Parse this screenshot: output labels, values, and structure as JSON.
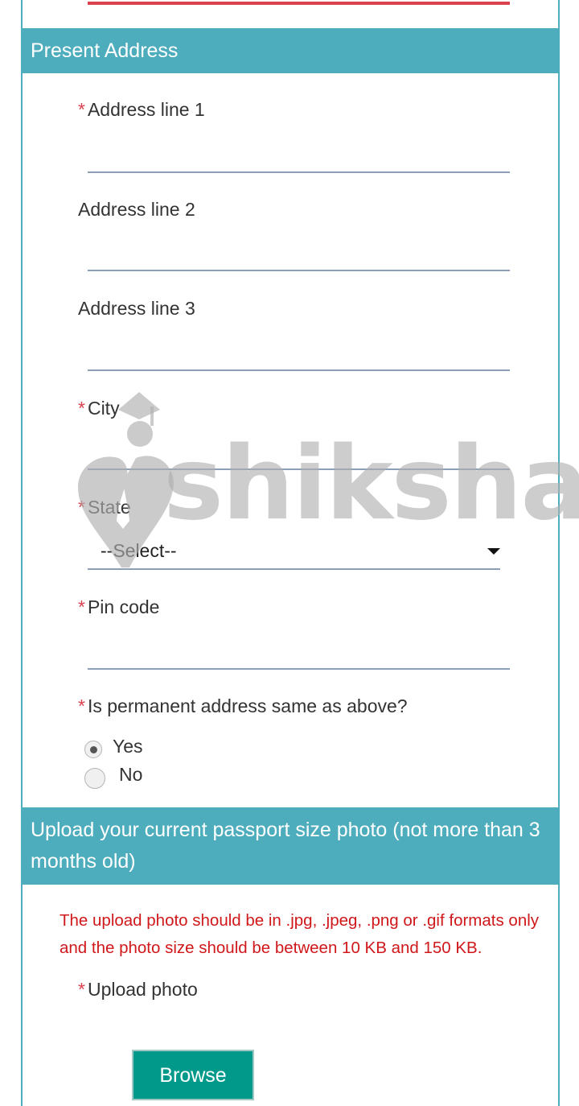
{
  "sections": {
    "present_address": "Present Address",
    "upload_photo": "Upload your current passport size photo (not more than 3 months old)"
  },
  "required_mark": "*",
  "fields": {
    "address1": {
      "label": "Address line 1",
      "value": ""
    },
    "address2": {
      "label": "Address line 2",
      "value": ""
    },
    "address3": {
      "label": "Address line 3",
      "value": ""
    },
    "city": {
      "label": "City",
      "value": ""
    },
    "state": {
      "label": "State",
      "selected": "--Select--"
    },
    "pincode": {
      "label": "Pin code",
      "value": ""
    }
  },
  "permanent_address": {
    "question": "Is permanent address same as above?",
    "options": [
      {
        "label": "Yes",
        "checked": true
      },
      {
        "label": "No",
        "checked": false
      }
    ]
  },
  "upload": {
    "notice": "The upload photo should be in .jpg, .jpeg, .png or .gif formats only and the photo size should be between 10 KB and 150 KB.",
    "label": "Upload photo",
    "button": "Browse"
  },
  "watermark": {
    "text": "shiksha",
    "icon": "shiksha-logo-icon"
  },
  "colors": {
    "header": "#4eadbd",
    "required": "#d9414e",
    "notice": "#d0171a",
    "button": "#00998a",
    "underline": "#8c9fb7"
  }
}
